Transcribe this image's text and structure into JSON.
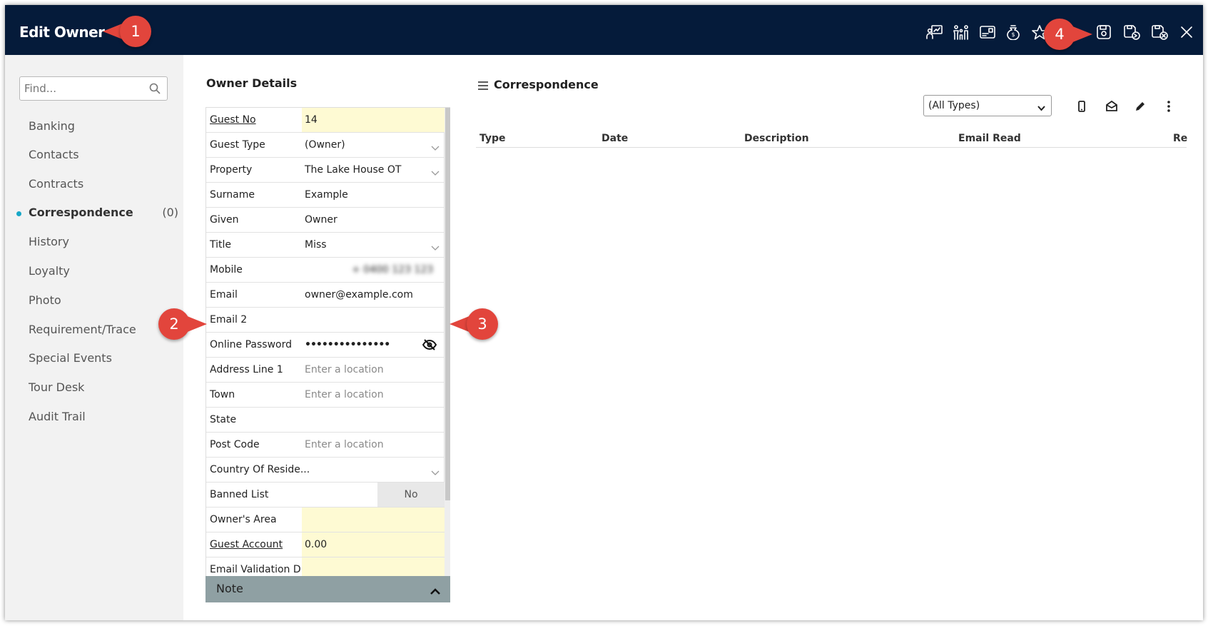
{
  "header": {
    "title": "Edit Owner",
    "icons": [
      "presentation-chart-icon",
      "family-icon",
      "id-card-icon",
      "money-bag-icon",
      "star-icon",
      "save-icon",
      "save-and-transfer-icon",
      "save-and-close-icon",
      "close-icon"
    ]
  },
  "callouts": [
    "1",
    "2",
    "3",
    "4"
  ],
  "sidebar": {
    "search_placeholder": "Find...",
    "items": [
      {
        "label": "Banking"
      },
      {
        "label": "Contacts"
      },
      {
        "label": "Contracts"
      },
      {
        "label": "Correspondence",
        "count": "(0)",
        "active": true
      },
      {
        "label": "History"
      },
      {
        "label": "Loyalty"
      },
      {
        "label": "Photo"
      },
      {
        "label": "Requirement/Trace"
      },
      {
        "label": "Special Events"
      },
      {
        "label": "Tour Desk"
      },
      {
        "label": "Audit Trail"
      }
    ]
  },
  "owner_details": {
    "title": "Owner Details",
    "fields": [
      {
        "label": "Guest No",
        "value": "14"
      },
      {
        "label": "Guest Type",
        "value": "(Owner)"
      },
      {
        "label": "Property",
        "value": "The Lake House OT"
      },
      {
        "label": "Surname",
        "value": "Example"
      },
      {
        "label": "Given",
        "value": "Owner"
      },
      {
        "label": "Title",
        "value": "Miss"
      },
      {
        "label": "Mobile",
        "value": "+ 0400 123 123"
      },
      {
        "label": "Email",
        "value": "owner@example.com"
      },
      {
        "label": "Email 2",
        "value": ""
      },
      {
        "label": "Online Password",
        "value": "•••••••••••••••"
      },
      {
        "label": "Address Line 1",
        "value": "",
        "placeholder": "Enter a location"
      },
      {
        "label": "Town",
        "value": "",
        "placeholder": "Enter a location"
      },
      {
        "label": "State",
        "value": ""
      },
      {
        "label": "Post Code",
        "value": "",
        "placeholder": "Enter a location"
      },
      {
        "label": "Country Of Reside...",
        "value": ""
      },
      {
        "label": "Banned List",
        "value": "No"
      },
      {
        "label": "Owner's Area",
        "value": ""
      },
      {
        "label": "Guest Account",
        "value": "0.00"
      },
      {
        "label": "Email Validation D...",
        "value": ""
      }
    ],
    "note_label": "Note"
  },
  "correspondence": {
    "title": "Correspondence",
    "filter_selected": "(All Types)",
    "tools": [
      "mobile-icon",
      "email-open-icon",
      "pencil-icon",
      "more-vertical-icon"
    ],
    "columns": [
      "Type",
      "Date",
      "Description",
      "Email Read",
      "Re"
    ]
  }
}
